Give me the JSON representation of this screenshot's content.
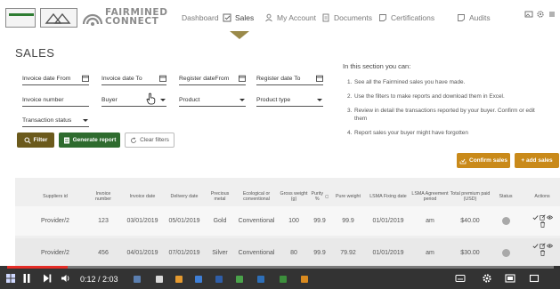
{
  "header": {
    "logo_small_text": "ALLIANCE FOR RESPONSIBLE MINING | FAIRMINED",
    "brand_line1": "FAIRMINED",
    "brand_line2": "CONNECT",
    "nav": [
      {
        "label": "Dashboard",
        "icon": "none"
      },
      {
        "label": "Sales",
        "icon": "checkbox-icon"
      },
      {
        "label": "My Account",
        "icon": "user-icon"
      },
      {
        "label": "Documents",
        "icon": "document-icon"
      },
      {
        "label": "Certifications",
        "icon": "certificate-icon"
      },
      {
        "label": "Audits",
        "icon": "audit-icon"
      }
    ],
    "active_tab": "Sales",
    "right_icons": [
      "image-icon",
      "gear-icon",
      "menu-icon"
    ]
  },
  "page": {
    "title": "SALES"
  },
  "filters": {
    "invoice_date_from": "Invoice date From",
    "invoice_date_to": "Invoice date To",
    "register_date_from": "Register dateFrom",
    "register_date_to": "Register date To",
    "invoice_number": "Invoice number",
    "buyer": "Buyer",
    "product": "Product",
    "product_type": "Product type",
    "transaction_status": "Transaction status"
  },
  "buttons": {
    "filter": "Filter",
    "generate_report": "Generate report",
    "clear_filters": "Clear filters",
    "confirm_sales": "Confirm sales",
    "add_sales": "+ add sales"
  },
  "help": {
    "heading": "In this section you can:",
    "items": [
      {
        "n": "1.",
        "text": "See all the Fairmined sales you have made."
      },
      {
        "n": "2.",
        "text": "Use the filters to make reports and download them in Excel."
      },
      {
        "n": "3.",
        "text": "Review in detail the transactions reported by your buyer. Confirm or edit them"
      },
      {
        "n": "4.",
        "text": "Report sales your buyer might have forgotten"
      }
    ]
  },
  "table": {
    "columns": [
      "Suppliers id",
      "Invoice number",
      "Invoice date",
      "Delivery date",
      "Precious metal",
      "Ecological or conventional",
      "Gross weight (g)",
      "Purity %",
      "Pure weight",
      "LSMA Fixing date",
      "LSMA Agreement period",
      "Total premium paid (USD)",
      "Status",
      "Actions"
    ],
    "rows": [
      [
        "Provider/2",
        "123",
        "03/01/2019",
        "05/01/2019",
        "Gold",
        "Conventional",
        "100",
        "99.9",
        "99.9",
        "01/01/2019",
        "am",
        "$40.00"
      ],
      [
        "Provider/2",
        "456",
        "04/01/2019",
        "07/01/2019",
        "Silver",
        "Conventional",
        "80",
        "99.9",
        "79.92",
        "01/01/2019",
        "am",
        "$30.00"
      ]
    ]
  },
  "player": {
    "time": "0:12 / 2:03",
    "progress": 0.11
  }
}
